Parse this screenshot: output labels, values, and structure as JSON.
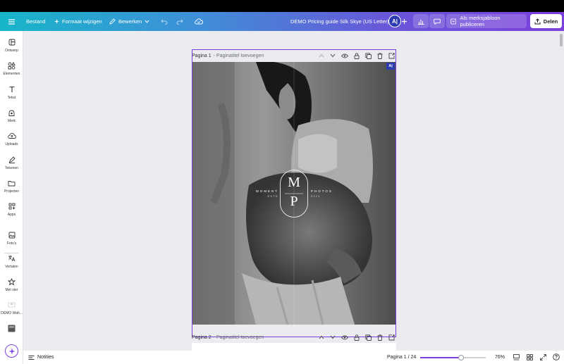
{
  "topbar": {
    "file_label": "Bestand",
    "resize_label": "Formaat wijzigen",
    "edit_label": "Bewerken",
    "doc_title": "DEMO Pricing guide Silk Skye (US Letter)",
    "avatar_initials": "A|",
    "publish_label": "Als merksjabloon publiceren",
    "share_label": "Delen"
  },
  "sidebar": {
    "items": [
      {
        "label": "Ontwerp",
        "icon": "layout-icon"
      },
      {
        "label": "Elementen",
        "icon": "shapes-icon"
      },
      {
        "label": "Tekst",
        "icon": "text-icon"
      },
      {
        "label": "Merk",
        "icon": "brand-icon"
      },
      {
        "label": "Uploads",
        "icon": "cloud-upload-icon"
      },
      {
        "label": "Tekenen",
        "icon": "pen-icon"
      },
      {
        "label": "Projecten",
        "icon": "folder-icon"
      },
      {
        "label": "Apps",
        "icon": "apps-icon"
      },
      {
        "label": "Foto's",
        "icon": "photo-icon"
      },
      {
        "label": "Vertalen",
        "icon": "translate-icon"
      },
      {
        "label": "Met ster",
        "icon": "star-icon"
      },
      {
        "label": "DEMO Wah...",
        "icon": "brand-kit-icon"
      },
      {
        "label": "",
        "icon": "image-thumb-icon"
      }
    ]
  },
  "pages": {
    "page1_label": "Pagina 1",
    "page1_title_placeholder": "- Paginatitel toevoegen",
    "page2_label": "Pagina 2",
    "page2_title_placeholder": "- Paginatitel toevoegen"
  },
  "design": {
    "logo_top": "M",
    "logo_bottom": "P",
    "left_word": "MOMENT",
    "left_small": "ESTD",
    "right_word": "PHOTOS",
    "right_small": "2024",
    "badge": "A|"
  },
  "bottombar": {
    "notes_label": "Notities",
    "page_indicator": "Pagina 1 / 24",
    "zoom_level": "76%",
    "zoom_fraction": 0.62
  },
  "colors": {
    "accent": "#7d3ee0",
    "topbar_start": "#17b5c9",
    "topbar_end": "#7b3fdc"
  }
}
